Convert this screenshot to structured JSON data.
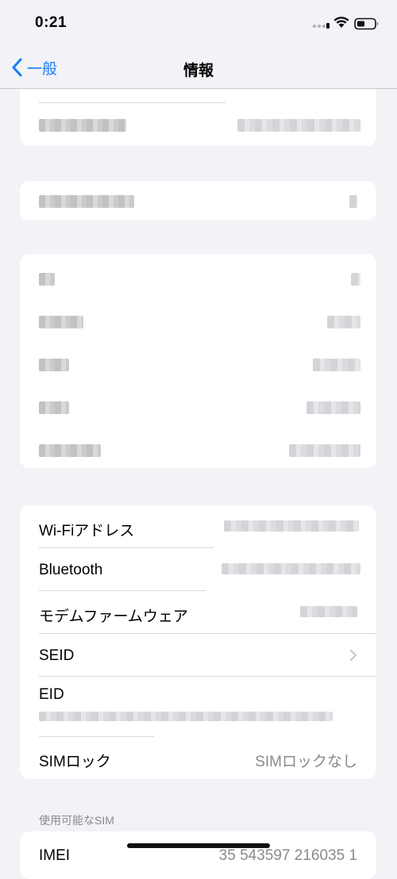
{
  "status_bar": {
    "time": "0:21"
  },
  "nav": {
    "back_label": "一般",
    "title": "情報"
  },
  "network_group": {
    "wifi_label": "Wi-Fiアドレス",
    "bluetooth_label": "Bluetooth",
    "modem_label": "モデムファームウェア",
    "seid_label": "SEID",
    "eid_label": "EID",
    "sim_lock_label": "SIMロック",
    "sim_lock_value": "SIMロックなし"
  },
  "available_sim": {
    "header": "使用可能なSIM",
    "imei_label": "IMEI",
    "imei_value": "35 543597 216035 1"
  },
  "colors": {
    "accent": "#1a7cf5",
    "background": "#f2f2f7",
    "secondary_text": "#8a8a8e"
  }
}
